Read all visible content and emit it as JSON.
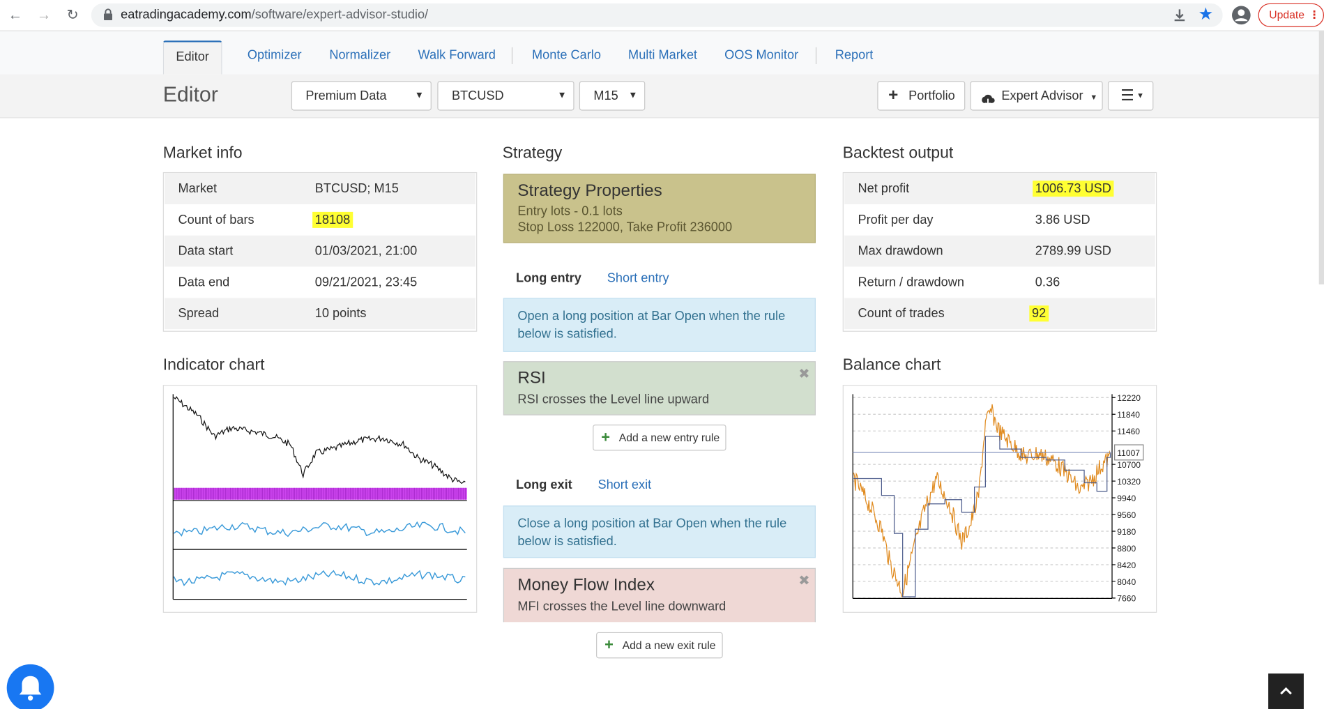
{
  "browser": {
    "url_domain": "eatradingacademy.com",
    "url_path": "/software/expert-advisor-studio/",
    "update_label": "Update"
  },
  "tabs": [
    "Editor",
    "Optimizer",
    "Normalizer",
    "Walk Forward",
    "Monte Carlo",
    "Multi Market",
    "OOS Monitor",
    "Report"
  ],
  "toolbar": {
    "title": "Editor",
    "data_source": "Premium Data",
    "symbol": "BTCUSD",
    "period": "M15",
    "portfolio_label": "Portfolio",
    "expert_advisor_label": "Expert Advisor"
  },
  "market_info": {
    "heading": "Market info",
    "rows": [
      {
        "label": "Market",
        "value": "BTCUSD; M15"
      },
      {
        "label": "Count of bars",
        "value": "18108"
      },
      {
        "label": "Data start",
        "value": "01/03/2021, 21:00"
      },
      {
        "label": "Data end",
        "value": "09/21/2021, 23:45"
      },
      {
        "label": "Spread",
        "value": "10 points"
      }
    ]
  },
  "strategy": {
    "heading": "Strategy",
    "properties_title": "Strategy Properties",
    "entry_lots": "Entry lots - 0.1 lots",
    "sl_tp": "Stop Loss 122000, Take Profit 236000",
    "long_entry_tab": "Long entry",
    "short_entry_tab": "Short entry",
    "entry_info": "Open a long position at Bar Open when the rule below is satisfied.",
    "entry_rule_title": "RSI",
    "entry_rule_desc": "RSI crosses the Level line upward",
    "add_entry_label": "Add a new entry rule",
    "long_exit_tab": "Long exit",
    "short_exit_tab": "Short exit",
    "exit_info": "Close a long position at Bar Open when the rule below is satisfied.",
    "exit_rule_title": "Money Flow Index",
    "exit_rule_desc": "MFI crosses the Level line downward",
    "add_exit_label": "Add a new exit rule"
  },
  "backtest": {
    "heading": "Backtest output",
    "rows": [
      {
        "label": "Net profit",
        "value": "1006.73 USD"
      },
      {
        "label": "Profit per day",
        "value": "3.86 USD"
      },
      {
        "label": "Max drawdown",
        "value": "2789.99 USD"
      },
      {
        "label": "Return / drawdown",
        "value": "0.36"
      },
      {
        "label": "Count of trades",
        "value": "92"
      }
    ]
  },
  "indicator_chart": {
    "heading": "Indicator chart"
  },
  "balance_chart": {
    "heading": "Balance chart",
    "y_ticks": [
      "12220",
      "11840",
      "11460",
      "10700",
      "10320",
      "9940",
      "9560",
      "9180",
      "8800",
      "8420",
      "8040",
      "7660"
    ],
    "current_value": "11007",
    "colors": {
      "price": "#e08a1e",
      "balance": "#4a5a8a"
    }
  },
  "colors": {
    "accent": "#2a6fb8",
    "highlight": "#ffff33",
    "props_bg": "#c9c28c",
    "entry_rule_bg": "#d2dfce",
    "exit_rule_bg": "#efd8d5",
    "info_bg": "#d9edf7"
  }
}
